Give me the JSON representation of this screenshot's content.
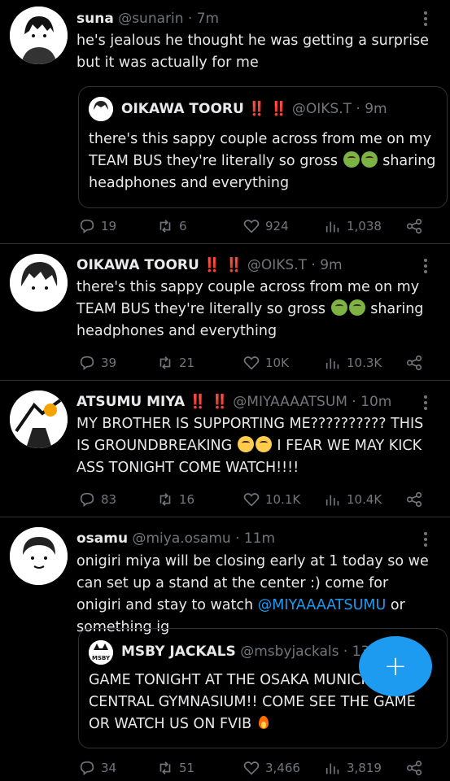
{
  "tweets": [
    {
      "name": "suna",
      "handle": "@sunarin",
      "time": "· 7m",
      "text": "he's jealous he thought he was getting a surprise but it was actually for me",
      "quote": {
        "name": "OIKAWA TOORU",
        "bang": "‼️ ‼️",
        "handle": "@OIKS.T",
        "time": "· 9m",
        "text1": "there's this sappy couple across from me on my TEAM BUS they're literally so gross",
        "text2": "sharing headphones and everything"
      },
      "stats": {
        "replies": "19",
        "retweets": "6",
        "likes": "924",
        "views": "1,038"
      }
    },
    {
      "name": "OIKAWA TOORU",
      "bang": "‼️ ‼️",
      "handle": "@OIKS.T",
      "time": "· 9m",
      "text1": "there's this sappy couple across from me on my TEAM BUS they're literally so gross",
      "text2": "sharing headphones and everything",
      "stats": {
        "replies": "39",
        "retweets": "21",
        "likes": "10K",
        "views": "10.3K"
      }
    },
    {
      "name": "ATSUMU MIYA",
      "bang": "‼️ ‼️",
      "handle": "@MIYAAAATSUM",
      "time": "· 10m",
      "text1": "MY BROTHER IS SUPPORTING ME?????????? THIS IS GROUNDBREAKING",
      "text2": "I FEAR WE MAY KICK ASS TONIGHT COME WATCH!!!!",
      "stats": {
        "replies": "83",
        "retweets": "16",
        "likes": "10.1K",
        "views": "10.4K"
      }
    },
    {
      "name": "osamu",
      "handle": "@miya.osamu",
      "time": "· 11m",
      "text1": "onigiri miya will be closing early at 1 today so we can set up a stand at the center :) come for onigiri and stay to watch",
      "mention": "@MIYAAAATSUMU",
      "text2": "or something ig",
      "quote": {
        "name": "MSBY JACKALS",
        "handle": "@msbyjackals",
        "time": "· 13m",
        "avatar_text": "MSBY",
        "text1": "GAME TONIGHT AT THE OSAKA MUNICIPAL CENTRAL GYMNASIUM!! COME SEE THE GAME OR WATCH US ON FVIB"
      },
      "stats": {
        "replies": "34",
        "retweets": "51",
        "likes": "3,466",
        "views": "3,819"
      }
    }
  ],
  "fab": {
    "label": "+"
  },
  "icons": [
    "reply-icon",
    "retweet-icon",
    "like-icon",
    "views-icon",
    "share-icon",
    "more-icon",
    "nauseated-face-emoji",
    "worried-face-emoji",
    "fire-emoji",
    "compose-icon"
  ],
  "colors": {
    "background": "#000000",
    "accent": "#1d9bf0",
    "muted": "#71767b",
    "text": "#e7e9ea",
    "alert": "#f4212e"
  }
}
